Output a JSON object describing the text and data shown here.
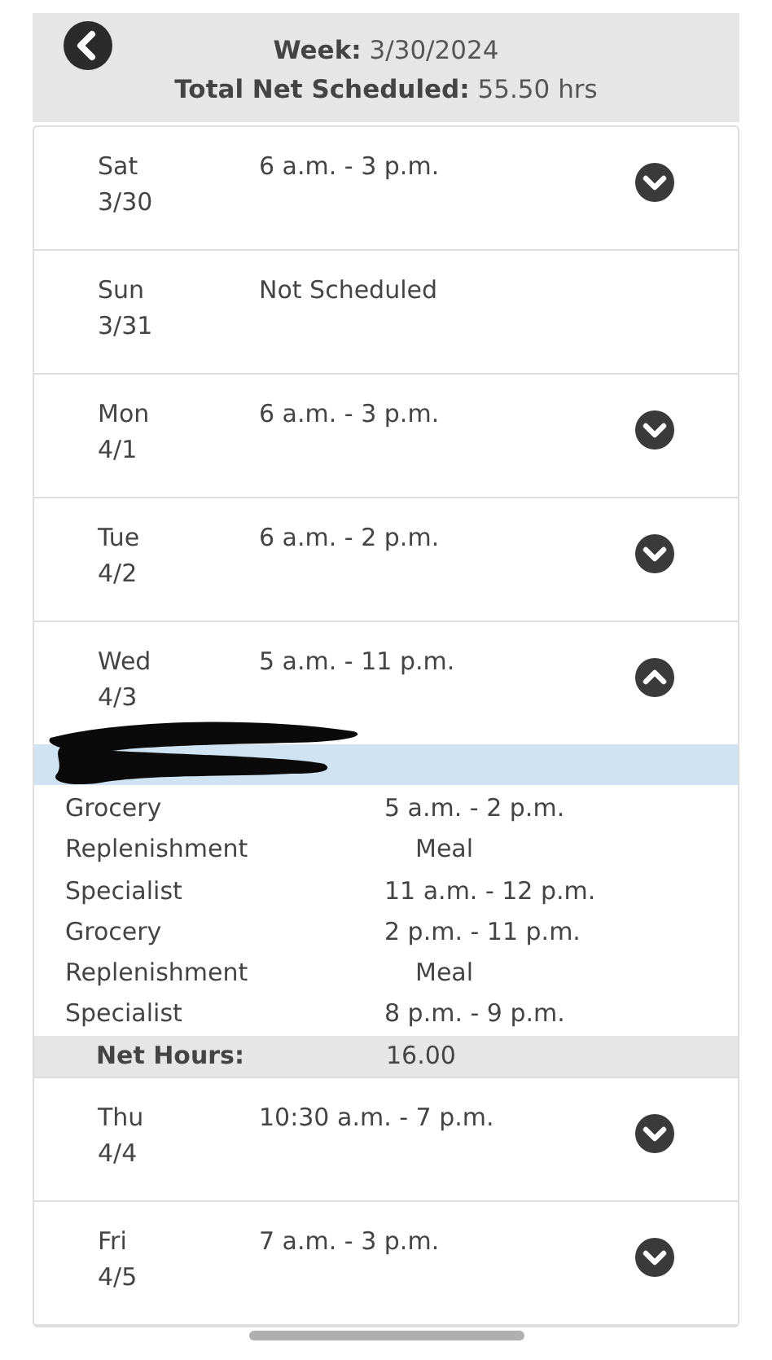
{
  "header": {
    "week_label": "Week:",
    "week": "3/30/2024",
    "total_label": "Total Net Scheduled:",
    "total": "55.50 hrs"
  },
  "days": [
    {
      "kind": "shift",
      "day": "Sat",
      "date": "3/30",
      "hours": "6 a.m. - 3 p.m.",
      "expanded": false
    },
    {
      "kind": "off",
      "day": "Sun",
      "date": "3/31",
      "hours": "Not Scheduled"
    },
    {
      "kind": "shift",
      "day": "Mon",
      "date": "4/1",
      "hours": "6 a.m. - 3 p.m.",
      "expanded": false
    },
    {
      "kind": "shift",
      "day": "Tue",
      "date": "4/2",
      "hours": "6 a.m. - 2 p.m.",
      "expanded": false
    },
    {
      "kind": "shift",
      "day": "Wed",
      "date": "4/3",
      "hours": "5 a.m. - 11 p.m.",
      "expanded": true,
      "details": {
        "segments": [
          {
            "job": "Grocery Replenishment Specialist",
            "lines": [
              {
                "kind": "shift",
                "text": "5 a.m. - 2 p.m."
              },
              {
                "kind": "break",
                "text": "Meal"
              },
              {
                "kind": "shift",
                "text": "11 a.m. - 12 p.m."
              }
            ]
          },
          {
            "job": "Grocery Replenishment Specialist",
            "lines": [
              {
                "kind": "shift",
                "text": "2 p.m. - 11 p.m."
              },
              {
                "kind": "break",
                "text": "Meal"
              },
              {
                "kind": "shift",
                "text": "8 p.m. - 9 p.m."
              }
            ]
          }
        ],
        "net_label": "Net Hours:",
        "net": "16.00"
      }
    },
    {
      "kind": "shift",
      "day": "Thu",
      "date": "4/4",
      "hours": "10:30 a.m. - 7 p.m.",
      "expanded": false
    },
    {
      "kind": "shift",
      "day": "Fri",
      "date": "4/5",
      "hours": "7 a.m. - 3 p.m.",
      "expanded": false
    }
  ]
}
